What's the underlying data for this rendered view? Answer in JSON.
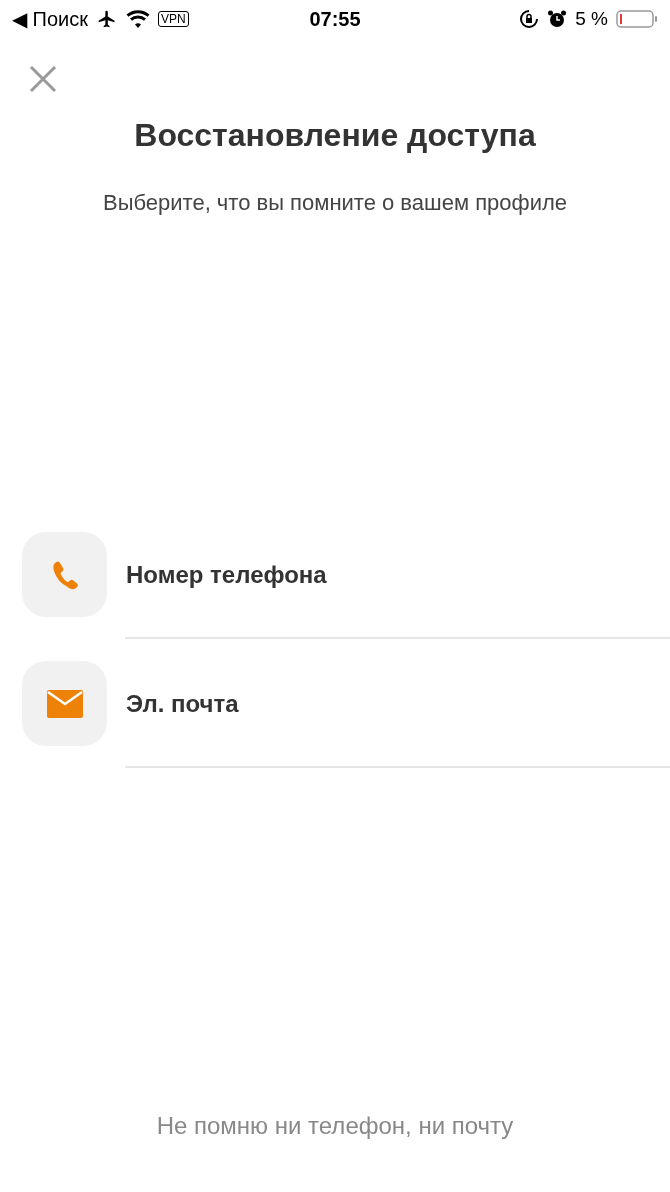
{
  "status_bar": {
    "back_label": "◀ Поиск",
    "vpn": "VPN",
    "time": "07:55",
    "battery": "5 %"
  },
  "title": "Восстановление доступа",
  "subtitle": "Выберите, что вы помните о вашем профиле",
  "options": [
    {
      "kind": "phone",
      "label": "Номер телефона"
    },
    {
      "kind": "email",
      "label": "Эл. почта"
    }
  ],
  "footer_link": "Не помню ни телефон, ни почту"
}
